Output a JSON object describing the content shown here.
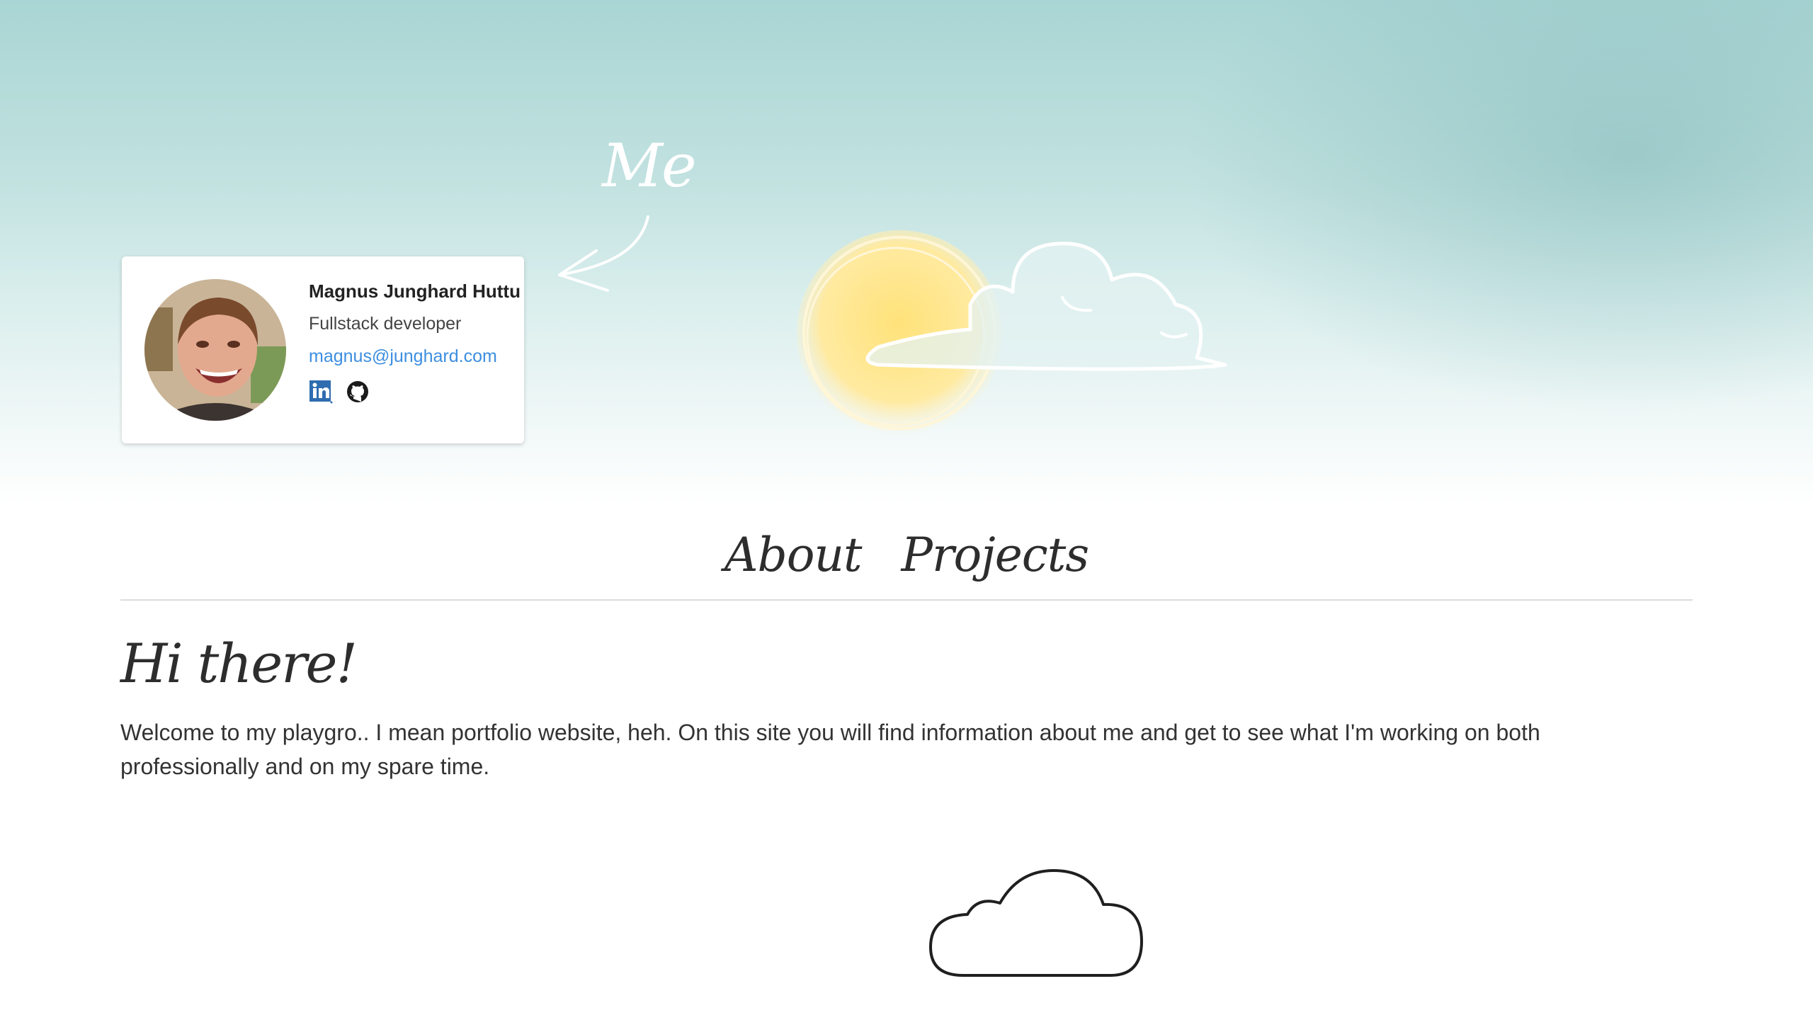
{
  "hero": {
    "me_label": "Me",
    "colors": {
      "sky_top": "#a9d5d4",
      "sun": "#ffe17a",
      "cloud": "#ffffff"
    }
  },
  "profile_card": {
    "name": "Magnus Junghard Huttu",
    "role": "Fullstack developer",
    "email": "magnus@junghard.com",
    "social": [
      {
        "icon": "linkedin-icon",
        "label": "LinkedIn",
        "color": "#2f6db0"
      },
      {
        "icon": "github-icon",
        "label": "GitHub",
        "color": "#1b1b1b"
      }
    ]
  },
  "nav": {
    "items": [
      {
        "label": "About"
      },
      {
        "label": "Projects"
      }
    ]
  },
  "main": {
    "heading": "Hi there!",
    "intro": "Welcome to my playgro.. I mean portfolio website, heh. On this site you will find information about me and get to see what I'm working on both professionally and on my spare time."
  },
  "colors": {
    "link": "#3d8ee0",
    "text": "#333333",
    "divider": "#dcdcdc"
  }
}
